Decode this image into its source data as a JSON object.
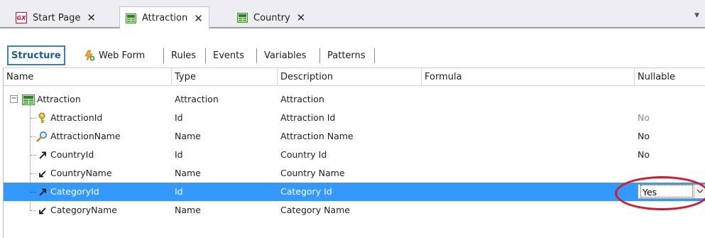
{
  "tabs": [
    {
      "label": "Start Page",
      "icon": "gx-icon",
      "close": "✕"
    },
    {
      "label": "Attraction",
      "icon": "transaction-icon",
      "close": "✕",
      "active": true
    },
    {
      "label": "Country",
      "icon": "transaction-icon",
      "close": "✕"
    }
  ],
  "parts": {
    "structure": "Structure",
    "web_form": "Web Form",
    "rules": "Rules",
    "events": "Events",
    "variables": "Variables",
    "patterns": "Patterns"
  },
  "columns": {
    "name": "Name",
    "type": "Type",
    "description": "Description",
    "formula": "Formula",
    "nullable": "Nullable"
  },
  "rows": [
    {
      "name": "Attraction",
      "type": "Attraction",
      "description": "Attraction",
      "nullable": "",
      "icon": "transaction-icon"
    },
    {
      "name": "AttractionId",
      "type": "Id",
      "description": "Attraction Id",
      "nullable": "No",
      "icon": "key-icon"
    },
    {
      "name": "AttractionName",
      "type": "Name",
      "description": "Attraction Name",
      "nullable": "No",
      "icon": "search-index-icon"
    },
    {
      "name": "CountryId",
      "type": "Id",
      "description": "Country Id",
      "nullable": "No",
      "icon": "foreign-key-icon"
    },
    {
      "name": "CountryName",
      "type": "Name",
      "description": "Country Name",
      "nullable": "",
      "icon": "inferred-attribute-icon"
    },
    {
      "name": "CategoryId",
      "type": "Id",
      "description": "Category Id",
      "nullable": "Yes",
      "icon": "foreign-key-icon",
      "selected": true
    },
    {
      "name": "CategoryName",
      "type": "Name",
      "description": "Category Name",
      "nullable": "",
      "icon": "inferred-attribute-icon"
    }
  ],
  "colors": {
    "selection": "#3399ff",
    "annotation": "#d7162a",
    "active_part": "#1a5d99"
  }
}
